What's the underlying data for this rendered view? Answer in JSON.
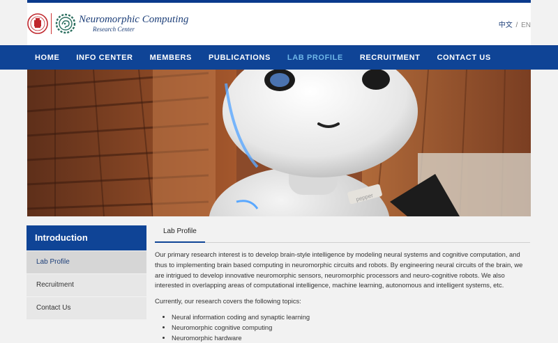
{
  "header": {
    "logo_title": "Neuromorphic Computing",
    "logo_subtitle": "Research Center",
    "lang_zh": "中文",
    "lang_sep": "/",
    "lang_en": "EN"
  },
  "nav": {
    "items": [
      {
        "label": "HOME"
      },
      {
        "label": "INFO CENTER"
      },
      {
        "label": "MEMBERS"
      },
      {
        "label": "PUBLICATIONS"
      },
      {
        "label": "LAB PROFILE"
      },
      {
        "label": "RECRUITMENT"
      },
      {
        "label": "CONTACT US"
      }
    ],
    "active_label": "LAB PROFILE"
  },
  "sidebar": {
    "title": "Introduction",
    "items": [
      {
        "label": "Lab Profile"
      },
      {
        "label": "Recruitment"
      },
      {
        "label": "Contact Us"
      }
    ]
  },
  "main": {
    "tab": "Lab Profile",
    "paragraph1": "Our primary research interest is to develop brain-style intelligence by modeling neural systems and cognitive computation, and thus to implementing brain based computing in neuromorphic circuits and robots. By engineering neural circuits of the brain, we are intrigued to develop innovative neuromorphic sensors, neuromorphic processors and neuro-cognitive robots. We also interested in overlapping areas of computational intelligence, machine learning, autonomous and intelligent systems, etc.",
    "paragraph2": "Currently, our research covers the following topics:",
    "topics": [
      "Neural information coding and synaptic learning",
      "Neuromorphic cognitive computing",
      "Neuromorphic hardware"
    ]
  },
  "hero": {
    "robot_tag": "pepper"
  },
  "colors": {
    "brand_blue": "#0f4496",
    "nav_active": "#6fb7e8",
    "sidebar_bg": "#e7e7e7"
  }
}
